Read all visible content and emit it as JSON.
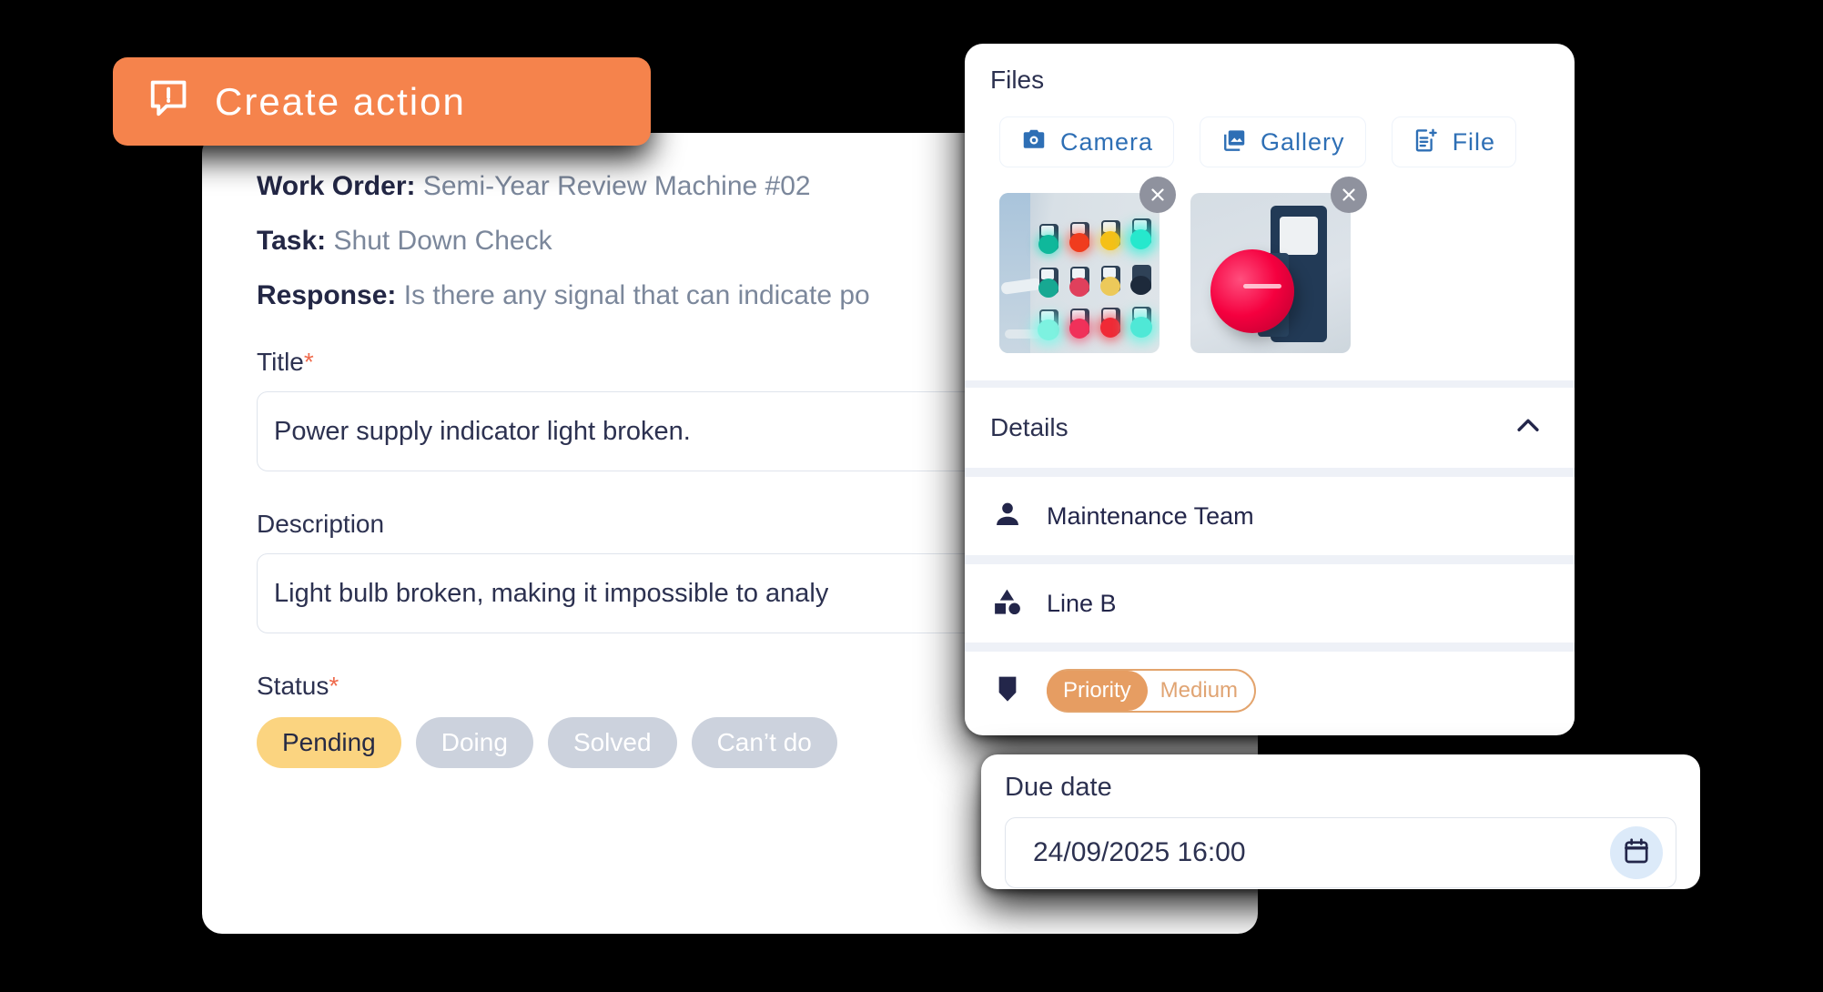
{
  "create_action": {
    "label": "Create action",
    "icon": "alert-message-icon",
    "color": "#F5834C"
  },
  "form": {
    "meta": [
      {
        "label": "Work Order:",
        "value": "Semi-Year Review Machine #02"
      },
      {
        "label": "Task:",
        "value": "Shut Down Check"
      },
      {
        "label": "Response:",
        "value": "Is there any signal that can indicate po"
      }
    ],
    "title_field": {
      "label": "Title",
      "required_mark": "*",
      "value": "Power supply indicator light broken."
    },
    "description_field": {
      "label": "Description",
      "value": "Light bulb broken, making it impossible to analy"
    },
    "status_field": {
      "label": "Status",
      "required_mark": "*",
      "options": [
        {
          "label": "Pending",
          "selected": true
        },
        {
          "label": "Doing",
          "selected": false
        },
        {
          "label": "Solved",
          "selected": false
        },
        {
          "label": "Can’t do",
          "selected": false
        }
      ],
      "selected_color": "#FBD480",
      "idle_color": "#CCD2DD"
    }
  },
  "files_panel": {
    "title": "Files",
    "buttons": [
      {
        "label": "Camera",
        "icon": "camera-icon"
      },
      {
        "label": "Gallery",
        "icon": "gallery-image-icon"
      },
      {
        "label": "File",
        "icon": "file-add-icon"
      }
    ],
    "button_text_color": "#2E6FB5",
    "attachments": [
      {
        "alt": "Indicator lamp control panel photo",
        "remove_icon": "close-icon"
      },
      {
        "alt": "Red emergency stop button photo",
        "remove_icon": "close-icon"
      }
    ]
  },
  "details": {
    "title": "Details",
    "collapse_icon": "chevron-up-icon",
    "rows": [
      {
        "icon": "person-icon",
        "label": "Maintenance Team"
      },
      {
        "icon": "shapes-icon",
        "label": "Line B"
      }
    ],
    "priority_row": {
      "icon": "shield-icon",
      "key": "Priority",
      "value": "Medium",
      "key_color": "#E69D62",
      "border_color": "#E3A46D"
    }
  },
  "due_date": {
    "title": "Due date",
    "value": "24/09/2025 16:00",
    "calendar_icon": "calendar-icon"
  }
}
